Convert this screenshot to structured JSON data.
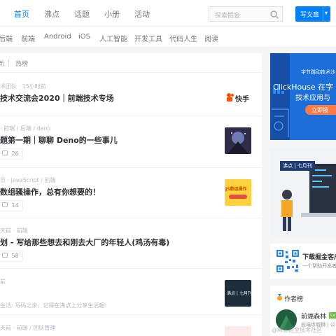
{
  "header": {
    "nav": [
      "首页",
      "沸点",
      "话题",
      "小册",
      "活动"
    ],
    "search_placeholder": "探索掘金",
    "write_button": "写文章",
    "caret": "▾"
  },
  "subnav": [
    "后端",
    "前端",
    "Android",
    "iOS",
    "人工智能",
    "开发工具",
    "代码人生",
    "阅读"
  ],
  "tabs": [
    "新",
    "热榜"
  ],
  "entries": [
    {
      "meta": "术团队 · 15小时前",
      "title": "技术交流会2020｜前端技术专场",
      "thumb_text": "快手"
    },
    {
      "meta": "· 前端 / 后端 / deno",
      "title": "题第一期｜聊聊 Deno的一些事儿",
      "count": "26"
    },
    {
      "meta": "员 · JavaScript / 前端",
      "title": "数组骚操作，总有你想要的！",
      "thumb_text": "JS数组操作",
      "count": "14"
    },
    {
      "meta": "天前 · 前端",
      "title": "划 - 写给那些想去和刚去大厂的年轻人(鸡汤有毒)",
      "count": "58"
    },
    {
      "meta": "前",
      "title": "生活: 写码之余，记得在沸点上分享生活喔!",
      "thumb_text": "沸点 | 七月刊"
    },
    {
      "meta": "天前 · 前端 / 团队管理"
    }
  ],
  "banner1": {
    "top": "字节跳动技术沙",
    "line1": "ClickHouse 在字",
    "line2": "技术应用与",
    "cta": "立即报"
  },
  "banner2": {
    "tag": "沸点 | 七月刊"
  },
  "app": {
    "title": "下载掘金客户",
    "sub": "一个帮助开发者"
  },
  "authors": {
    "title": "作者榜",
    "name": "前端森林",
    "badge": "Lv",
    "sub": "前端攻城狮 | 公",
    "watermark": "@稀土掘金技术社区"
  },
  "colors": {
    "accent": "#007fff",
    "banner": "#1c6fd8",
    "orange": "#f5a623"
  }
}
